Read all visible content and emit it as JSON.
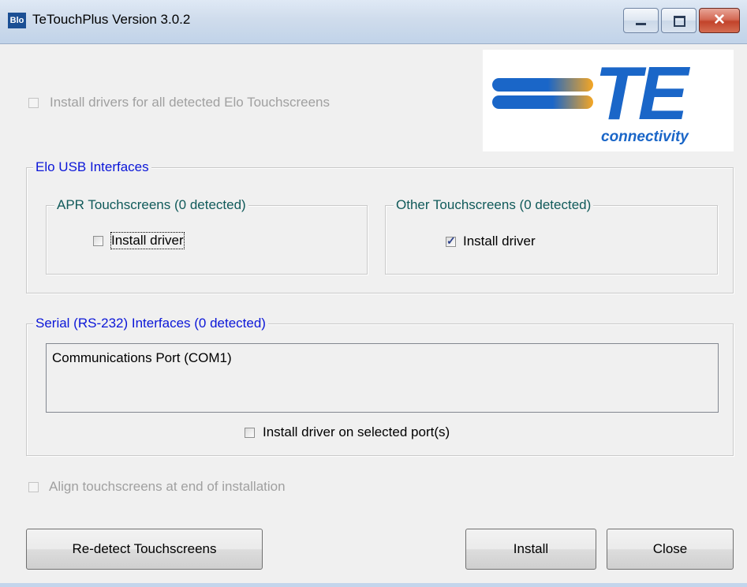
{
  "window": {
    "title": "TeTouchPlus Version 3.0.2",
    "app_icon_text": "Blo",
    "close_glyph": "✕"
  },
  "logo": {
    "wordmark": "TE",
    "tagline": "connectivity",
    "brand_color": "#1a66c8",
    "stripe_orange": "#f5a623"
  },
  "all_drivers": {
    "label": "Install drivers for all detected Elo Touchscreens",
    "checked": false,
    "enabled": false
  },
  "usb": {
    "title": "Elo USB Interfaces",
    "apr": {
      "title": "APR Touchscreens (0 detected)",
      "install_label": "Install driver",
      "checked": false
    },
    "other": {
      "title": "Other Touchscreens (0 detected)",
      "install_label": "Install driver",
      "checked": true
    }
  },
  "serial": {
    "title": "Serial (RS-232) Interfaces (0 detected)",
    "ports": [
      "Communications Port (COM1)"
    ],
    "install_label": "Install driver on selected port(s)",
    "checked": false
  },
  "align": {
    "label": "Align touchscreens at end of installation",
    "checked": false,
    "enabled": false
  },
  "buttons": {
    "redetect": "Re-detect Touchscreens",
    "install": "Install",
    "close": "Close"
  },
  "tick_glyph": "✓"
}
